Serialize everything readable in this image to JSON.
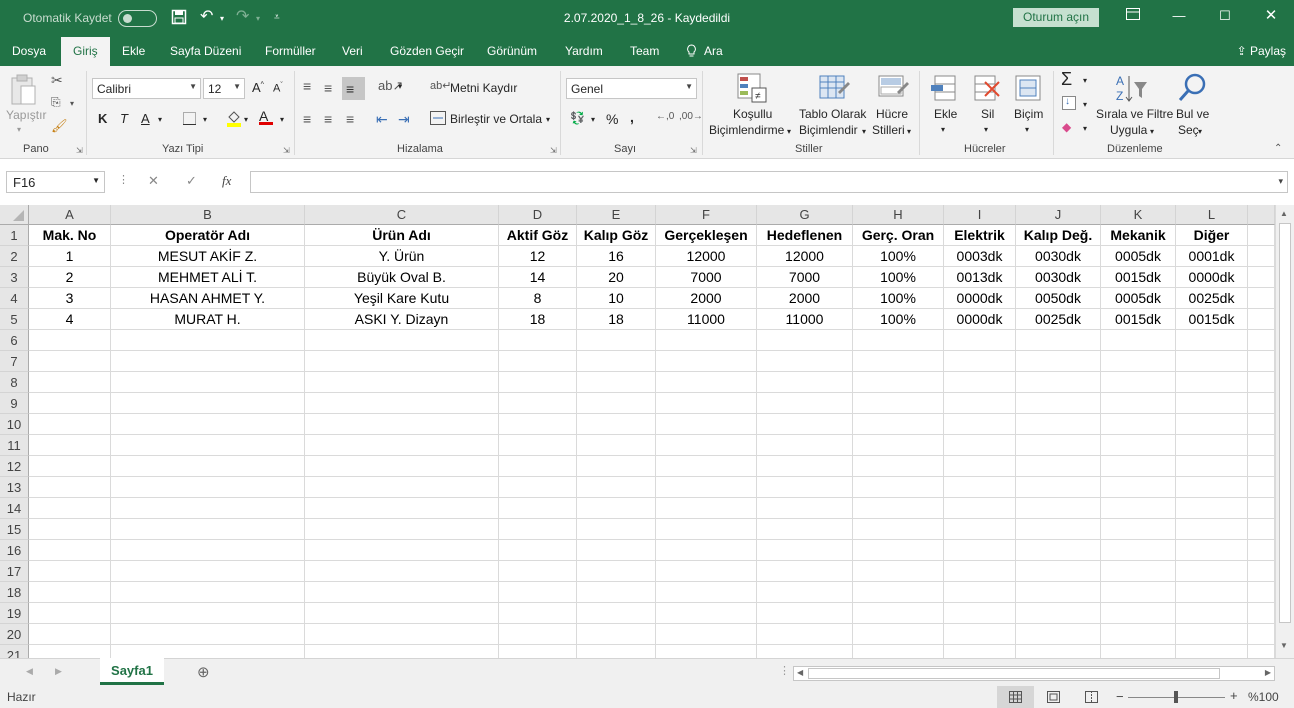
{
  "titlebar": {
    "autosave_label": "Otomatik Kaydet",
    "doc_title": "2.07.2020_1_8_26  -  Kaydedildi",
    "signin_label": "Oturum açın"
  },
  "tabs": [
    "Dosya",
    "Giriş",
    "Ekle",
    "Sayfa Düzeni",
    "Formüller",
    "Veri",
    "Gözden Geçir",
    "Görünüm",
    "Yardım",
    "Team",
    "Ara"
  ],
  "share_label": "Paylaş",
  "ribbon": {
    "paste_label": "Yapıştır",
    "group_labels": [
      "Pano",
      "Yazı Tipi",
      "Hizalama",
      "Sayı",
      "Stiller",
      "Hücreler",
      "Düzenleme"
    ],
    "font_name": "Calibri",
    "font_size": "12",
    "bold": "K",
    "italic": "T",
    "underline": "A",
    "wrap_text": "Metni Kaydır",
    "merge_center": "Birleştir ve Ortala",
    "number_format": "Genel",
    "percent": "%",
    "comma": ",",
    "cond_format_1": "Koşullu",
    "cond_format_2": "Biçimlendirme",
    "table_format_1": "Tablo Olarak",
    "table_format_2": "Biçimlendir",
    "cell_styles_1": "Hücre",
    "cell_styles_2": "Stilleri",
    "insert": "Ekle",
    "delete": "Sil",
    "format": "Biçim",
    "sort_filter_1": "Sırala ve Filtre",
    "sort_filter_2": "Uygula",
    "find_select_1": "Bul ve",
    "find_select_2": "Seç"
  },
  "formula_bar": {
    "name_box": "F16",
    "fx": "fx",
    "formula": ""
  },
  "columns": [
    "A",
    "B",
    "C",
    "D",
    "E",
    "F",
    "G",
    "H",
    "I",
    "J",
    "K",
    "L"
  ],
  "rows": [
    [
      "Mak. No",
      "Operatör Adı",
      "Ürün Adı",
      "Aktif Göz",
      "Kalıp Göz",
      "Gerçekleşen",
      "Hedeflenen",
      "Gerç. Oran",
      "Elektrik",
      "Kalıp Değ.",
      "Mekanik",
      "Diğer"
    ],
    [
      "1",
      "MESUT AKİF Z.",
      "Y. Ürün",
      "12",
      "16",
      "12000",
      "12000",
      "100%",
      "0003dk",
      "0030dk",
      "0005dk",
      "0001dk"
    ],
    [
      "2",
      "MEHMET ALİ T.",
      "Büyük Oval B.",
      "14",
      "20",
      "7000",
      "7000",
      "100%",
      "0013dk",
      "0030dk",
      "0015dk",
      "0000dk"
    ],
    [
      "3",
      "HASAN AHMET Y.",
      "Yeşil Kare Kutu",
      "8",
      "10",
      "2000",
      "2000",
      "100%",
      "0000dk",
      "0050dk",
      "0005dk",
      "0025dk"
    ],
    [
      "4",
      "MURAT H.",
      "ASKI Y. Dizayn",
      "18",
      "18",
      "11000",
      "11000",
      "100%",
      "0000dk",
      "0025dk",
      "0015dk",
      "0015dk"
    ]
  ],
  "row_numbers": [
    "1",
    "2",
    "3",
    "4",
    "5",
    "6",
    "7",
    "8",
    "9",
    "10",
    "11",
    "12",
    "13",
    "14",
    "15",
    "16",
    "17",
    "18",
    "19",
    "20",
    "21"
  ],
  "sheet_tab": "Sayfa1",
  "status": {
    "ready": "Hazır",
    "zoom": "%100",
    "minus": "−",
    "plus": "+"
  }
}
